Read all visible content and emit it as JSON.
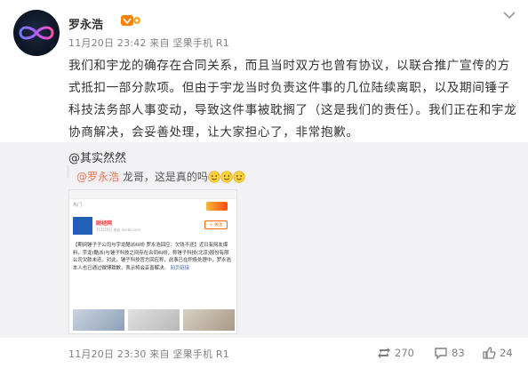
{
  "post": {
    "author": "罗永浩",
    "timestamp": "11月20日 23:42",
    "source_prefix": "来自",
    "source": "坚果手机 R1",
    "text": "我们和宇龙的确存在合同关系，而且当时双方也曾有协议，以联合推广宣传的方式抵扣一部分款项。但由于宇龙当时负责这件事的几位陆续离职，以及期间锤子科技法务部人事变动，导致这件事被耽搁了（这是我们的责任）。我们正在和宇龙协商解决，会妥善处理，让大家担心了，非常抱歉。"
  },
  "repost": {
    "author_prefix": "@",
    "author": "其实然然",
    "mention": "@罗永浩",
    "text": " 龙哥，这是真的吗",
    "emoji_count": 3,
    "screenshot": {
      "topbar_label": "热门",
      "source_name": "财经网",
      "source_sub": "11月20日 来自 weibo.com",
      "follow_label": "+ 关注",
      "body": "【期间锤子子公司与宇龙酷派纠纷 罗永浩回应：欠钱不还】近日有网友爆料，宇龙(酷派)与锤子科技之间存在合同纠纷，称锤子科技(北京)股份有限公司欠款未还。对此，锤子科技官方回应称，此事已在积极处理中，罗永浩本人也已通过微博致歉，表示将会妥善解决。",
      "link_text": "网页链接"
    }
  },
  "footer": {
    "timestamp": "11月20日 23:30",
    "source_prefix": "来自",
    "source": "坚果手机 R1",
    "reposts": "270",
    "comments": "83",
    "likes": "24"
  },
  "colors": {
    "mention": "#eb7350",
    "meta": "#808080",
    "repost_bg": "#f2f2f5"
  },
  "icons": [
    "verified-vip-icon",
    "chevron-down-icon",
    "repost-icon",
    "comment-icon",
    "like-icon",
    "sweat-smile-emoji"
  ]
}
